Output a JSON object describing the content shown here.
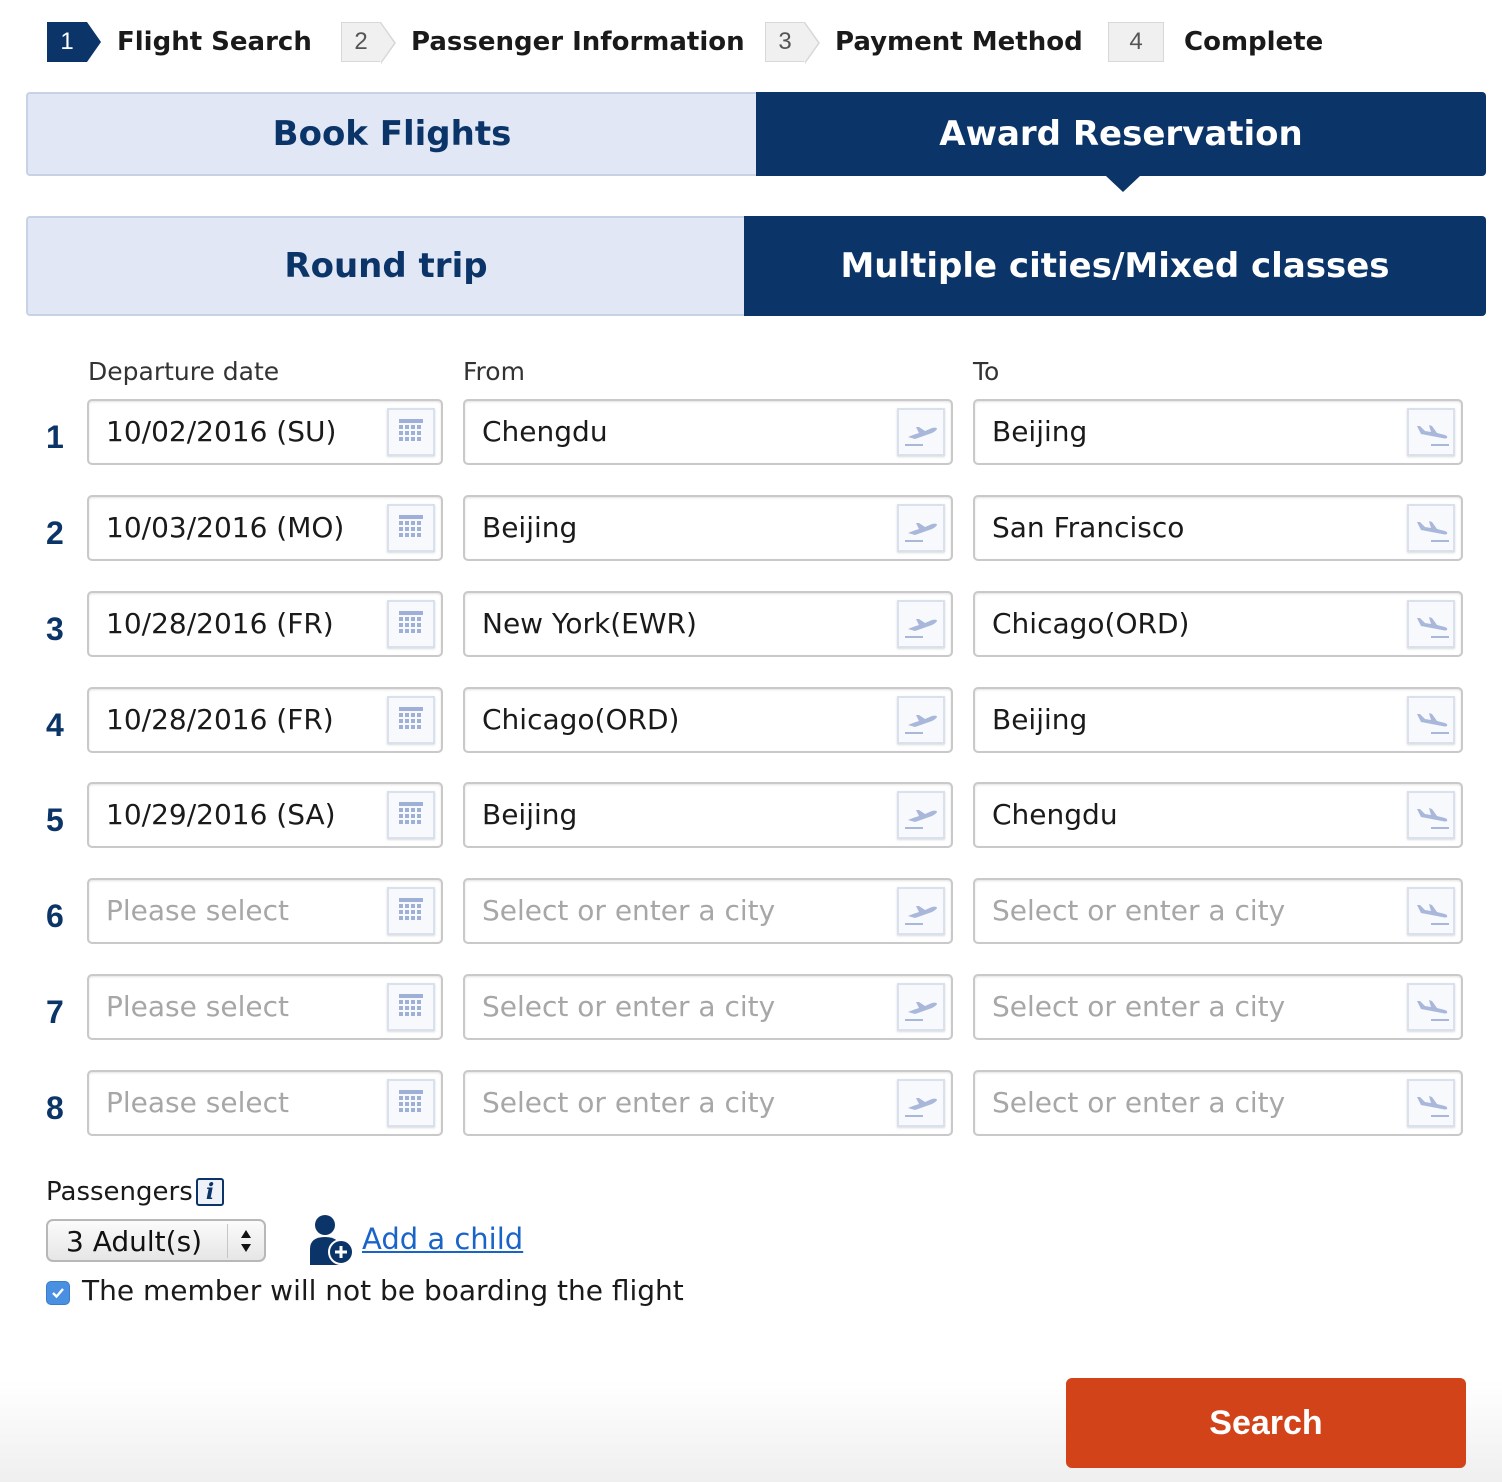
{
  "steps": [
    {
      "num": "1",
      "label": "Flight Search",
      "state": "active"
    },
    {
      "num": "2",
      "label": "Passenger Information",
      "state": "inactive"
    },
    {
      "num": "3",
      "label": "Payment Method",
      "state": "inactive"
    },
    {
      "num": "4",
      "label": "Complete",
      "state": "inactive"
    }
  ],
  "booking_tabs": {
    "book_flights": "Book Flights",
    "award_reservation": "Award Reservation",
    "selected": "award_reservation"
  },
  "trip_tabs": {
    "round_trip": "Round trip",
    "multi_city": "Multiple cities/Mixed classes",
    "selected": "multi_city"
  },
  "form": {
    "columns": {
      "date": "Departure date",
      "from": "From",
      "to": "To"
    },
    "date_placeholder": "Please select",
    "city_placeholder": "Select or enter a city",
    "segments": [
      {
        "num": "1",
        "date": "10/02/2016 (SU)",
        "from": "Chengdu",
        "to": "Beijing"
      },
      {
        "num": "2",
        "date": "10/03/2016 (MO)",
        "from": "Beijing",
        "to": "San Francisco"
      },
      {
        "num": "3",
        "date": "10/28/2016 (FR)",
        "from": "New York(EWR)",
        "to": "Chicago(ORD)"
      },
      {
        "num": "4",
        "date": "10/28/2016 (FR)",
        "from": "Chicago(ORD)",
        "to": "Beijing"
      },
      {
        "num": "5",
        "date": "10/29/2016 (SA)",
        "from": "Beijing",
        "to": "Chengdu"
      },
      {
        "num": "6",
        "date": "",
        "from": "",
        "to": ""
      },
      {
        "num": "7",
        "date": "",
        "from": "",
        "to": ""
      },
      {
        "num": "8",
        "date": "",
        "from": "",
        "to": ""
      }
    ],
    "icons": {
      "date": "calendar-icon",
      "from": "departure-plane-icon",
      "to": "arrival-plane-icon"
    }
  },
  "passengers": {
    "label": "Passengers",
    "info_icon": "i",
    "selected": "3 Adult(s)",
    "add_child": "Add a child",
    "member_checkbox": {
      "label": "The member will not be boarding the flight",
      "checked": true
    }
  },
  "search_button": "Search",
  "colors": {
    "primary": "#0b3468",
    "tab_inactive_bg": "#e1e7f5",
    "search": "#d2431a",
    "link": "#1a64c9",
    "checkbox": "#4a90e2"
  }
}
